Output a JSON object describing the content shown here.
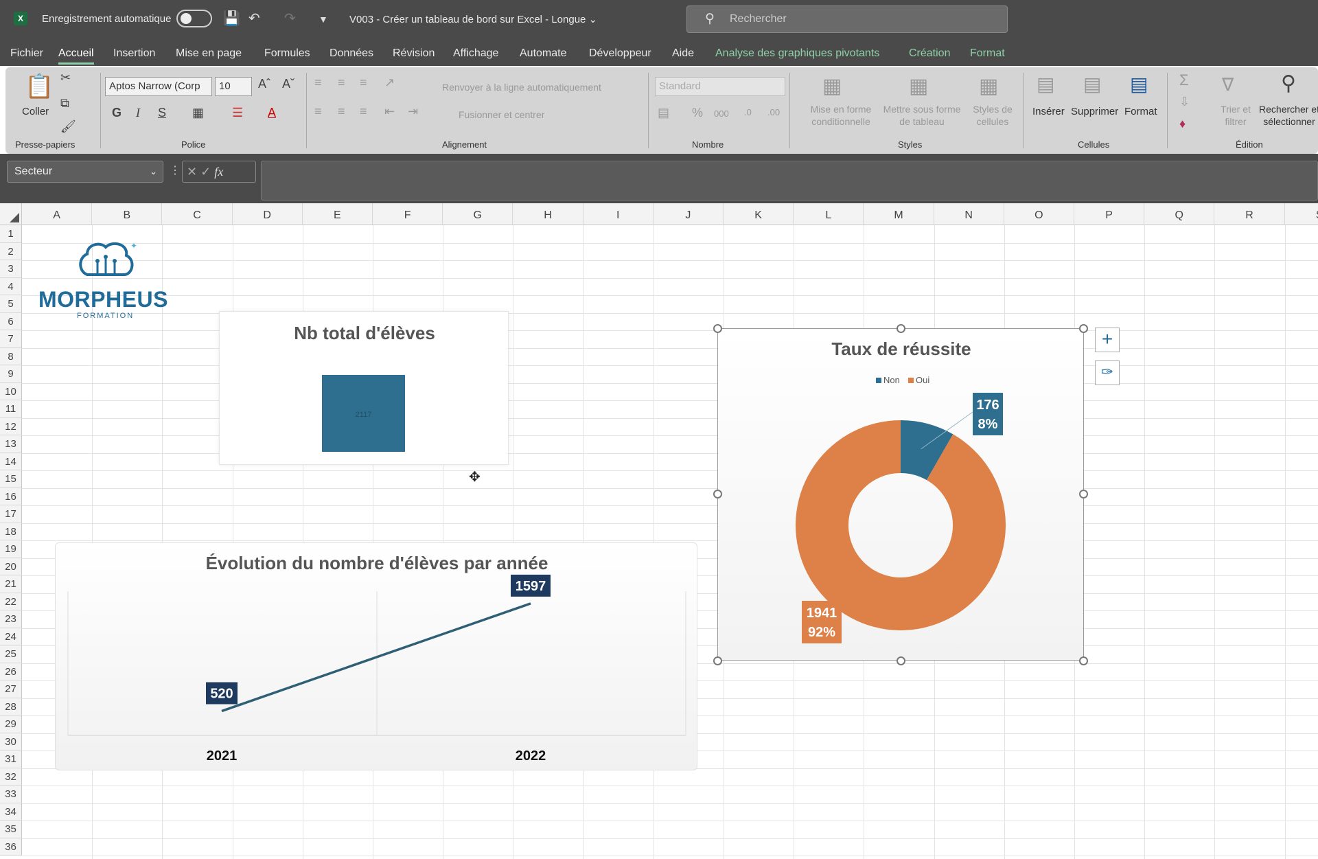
{
  "titlebar": {
    "autosave_label": "Enregistrement automatique",
    "doc_title": "V003 - Créer un tableau de bord sur Excel - Longue",
    "search_placeholder": "Rechercher"
  },
  "menu": [
    "Fichier",
    "Accueil",
    "Insertion",
    "Mise en page",
    "Formules",
    "Données",
    "Révision",
    "Affichage",
    "Automate",
    "Développeur",
    "Aide",
    "Analyse des graphiques pivotants",
    "Création",
    "Format"
  ],
  "ribbon": {
    "clipboard": {
      "paste": "Coller",
      "label": "Presse-papiers"
    },
    "font": {
      "name": "Aptos Narrow (Corp",
      "size": "10",
      "label": "Police",
      "bold": "G",
      "italic": "I",
      "underline": "S"
    },
    "alignment": {
      "wrap": "Renvoyer à la ligne automatiquement",
      "merge": "Fusionner et centrer",
      "label": "Alignement"
    },
    "number": {
      "format": "Standard",
      "label": "Nombre"
    },
    "styles": {
      "conditional": "Mise en forme conditionnelle",
      "table": "Mettre sous forme de tableau",
      "cell": "Styles de cellules",
      "label": "Styles"
    },
    "cells": {
      "insert": "Insérer",
      "delete": "Supprimer",
      "format": "Format",
      "label": "Cellules"
    },
    "editing": {
      "sort": "Trier et filtrer",
      "find": "Rechercher et sélectionner",
      "label": "Édition"
    }
  },
  "formula": {
    "namebox": "Secteur"
  },
  "columns": [
    "A",
    "B",
    "C",
    "D",
    "E",
    "F",
    "G",
    "H",
    "I",
    "J",
    "K",
    "L",
    "M",
    "N",
    "O",
    "P",
    "Q",
    "R",
    "S"
  ],
  "rows": [
    "1",
    "2",
    "3",
    "4",
    "5",
    "6",
    "7",
    "8",
    "9",
    "10",
    "11",
    "12",
    "13",
    "14",
    "15",
    "16",
    "17",
    "18",
    "19",
    "20",
    "21",
    "22",
    "23",
    "24",
    "25",
    "26",
    "27",
    "28",
    "29",
    "30",
    "31",
    "32",
    "33",
    "34",
    "35",
    "36"
  ],
  "logo": {
    "name": "MORPHEUS",
    "sub": "FORMATION"
  },
  "chart_data": [
    {
      "type": "bar",
      "title": "Nb total d'élèves",
      "values": [
        2117
      ],
      "categories": [
        ""
      ],
      "color": "#2e6e8e"
    },
    {
      "type": "line",
      "title": "Évolution du nombre d'élèves par année",
      "categories": [
        "2021",
        "2022"
      ],
      "values": [
        520,
        1597
      ],
      "labels": [
        "520",
        "1597"
      ],
      "color": "#2e5f75",
      "label_bg": "#1e3a5f"
    },
    {
      "type": "pie",
      "title": "Taux de réussite",
      "donut": true,
      "legend": "top",
      "series": [
        {
          "name": "Non",
          "value": 176,
          "percent": "8%",
          "color": "#2e6e8e"
        },
        {
          "name": "Oui",
          "value": 1941,
          "percent": "92%",
          "color": "#dd8148"
        }
      ]
    }
  ]
}
